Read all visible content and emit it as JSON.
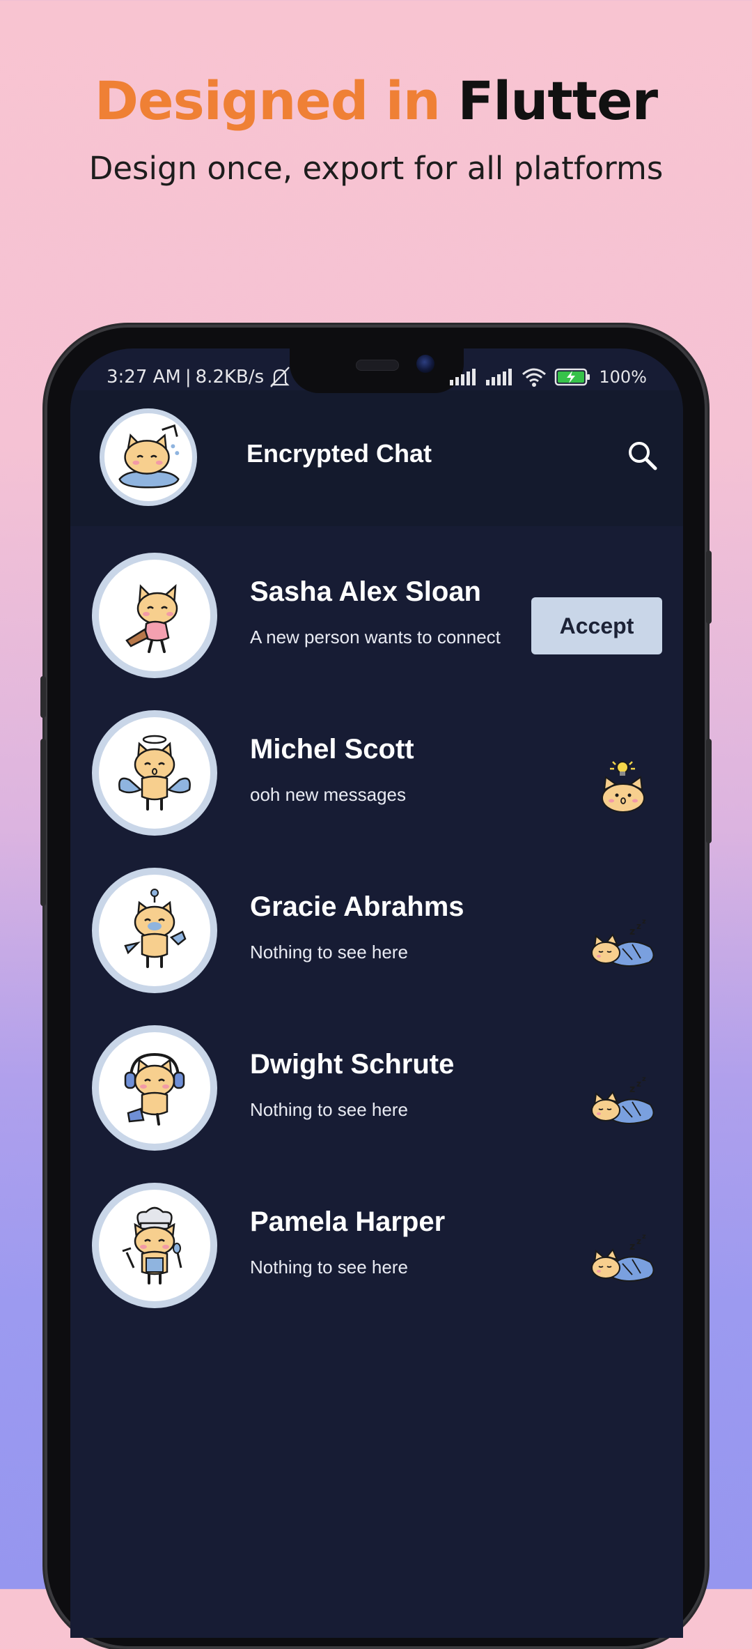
{
  "promo": {
    "headline_accent": "Designed in",
    "headline_main": "Flutter",
    "subline": "Design once, export for all platforms"
  },
  "statusbar": {
    "time": "3:27 AM",
    "separator": "|",
    "speed": "8.2KB/s",
    "battery": "100%"
  },
  "appbar": {
    "title": "Encrypted Chat"
  },
  "chats": [
    {
      "name": "Sasha Alex Sloan",
      "preview": "A new person wants to connect",
      "action": "Accept"
    },
    {
      "name": "Michel Scott",
      "preview": "ooh new messages",
      "status": "idea-cat-sticker"
    },
    {
      "name": "Gracie Abrahms",
      "preview": "Nothing to see here",
      "status": "sleeping-cat-sticker"
    },
    {
      "name": "Dwight Schrute",
      "preview": "Nothing to see here",
      "status": "sleeping-cat-sticker"
    },
    {
      "name": "Pamela Harper",
      "preview": "Nothing to see here",
      "status": "sleeping-cat-sticker"
    }
  ],
  "colors": {
    "screen_bg": "#171c34",
    "appbar_bg": "#141a2d",
    "avatar_ring": "#c9d6e8",
    "accent_orange": "#ef8035"
  }
}
